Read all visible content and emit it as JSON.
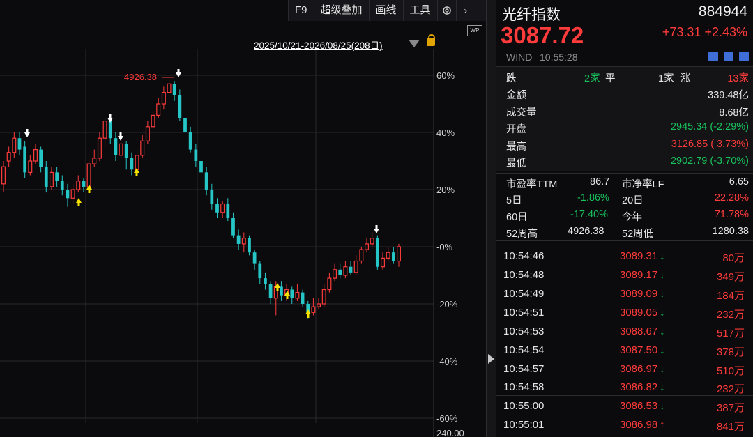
{
  "toolbar": {
    "f9": "F9",
    "overlay": "超级叠加",
    "draw": "画线",
    "tools": "工具",
    "settings_icon": "gear-icon",
    "more_icon": "chevron-right-icon"
  },
  "chart": {
    "wp_badge": "WP",
    "range": "2025/10/21-2026/08/25(208日)",
    "high_marker": "4926.38",
    "y_ticks": [
      "60%",
      "40%",
      "20%",
      "-0%",
      "-20%",
      "-40%",
      "-60%"
    ],
    "bottom_label": "240.00"
  },
  "chart_data": {
    "type": "candlestick",
    "y_axis": "percent change",
    "ylim": [
      -60,
      60
    ],
    "high_value": 4926.38,
    "colors": {
      "up": "#ff3b3b",
      "down": "#26c6c6",
      "grid": "#2a2a2e"
    },
    "candles": [
      [
        22,
        28,
        19,
        30
      ],
      [
        30,
        33,
        28,
        35
      ],
      [
        33,
        38,
        31,
        40
      ],
      [
        38,
        34,
        32,
        40
      ],
      [
        35,
        26,
        24,
        37
      ],
      [
        26,
        30,
        25,
        32
      ],
      [
        30,
        34,
        29,
        36
      ],
      [
        34,
        28,
        26,
        35
      ],
      [
        28,
        21,
        19,
        30
      ],
      [
        21,
        26,
        20,
        28
      ],
      [
        26,
        23,
        21,
        28
      ],
      [
        23,
        20,
        18,
        25
      ],
      [
        20,
        17,
        14,
        22
      ],
      [
        17,
        20,
        15,
        22
      ],
      [
        20,
        23,
        19,
        25
      ],
      [
        23,
        21,
        19,
        24
      ],
      [
        21,
        29,
        20,
        30
      ],
      [
        29,
        31,
        28,
        34
      ],
      [
        31,
        38,
        30,
        40
      ],
      [
        38,
        44,
        35,
        45
      ],
      [
        44,
        38,
        36,
        46
      ],
      [
        38,
        32,
        30,
        40
      ],
      [
        32,
        36,
        31,
        38
      ],
      [
        36,
        31,
        27,
        37
      ],
      [
        31,
        27,
        25,
        33
      ],
      [
        27,
        32,
        26,
        34
      ],
      [
        32,
        37,
        31,
        39
      ],
      [
        37,
        42,
        36,
        44
      ],
      [
        42,
        46,
        41,
        48
      ],
      [
        46,
        50,
        45,
        52
      ],
      [
        50,
        54,
        48,
        56
      ],
      [
        54,
        57,
        52,
        59
      ],
      [
        57,
        53,
        51,
        58
      ],
      [
        53,
        45,
        44,
        55
      ],
      [
        45,
        40,
        37,
        46
      ],
      [
        40,
        34,
        33,
        42
      ],
      [
        34,
        30,
        28,
        36
      ],
      [
        30,
        26,
        24,
        31
      ],
      [
        26,
        20,
        18,
        28
      ],
      [
        20,
        15,
        13,
        22
      ],
      [
        15,
        12,
        10,
        17
      ],
      [
        12,
        15,
        10,
        16
      ],
      [
        15,
        10,
        9,
        17
      ],
      [
        10,
        4,
        3,
        12
      ],
      [
        4,
        1,
        -1,
        6
      ],
      [
        1,
        3,
        -2,
        5
      ],
      [
        3,
        -2,
        -3,
        4
      ],
      [
        -2,
        -6,
        -8,
        -1
      ],
      [
        -6,
        -11,
        -13,
        -5
      ],
      [
        -11,
        -13,
        -15,
        -9
      ],
      [
        -13,
        -18,
        -20,
        -12
      ],
      [
        -18,
        -14,
        -24,
        -12
      ],
      [
        -14,
        -17,
        -19,
        -12
      ],
      [
        -17,
        -15,
        -19,
        -13
      ],
      [
        -15,
        -18,
        -20,
        -14
      ],
      [
        -18,
        -16,
        -19,
        -13
      ],
      [
        -16,
        -20,
        -21,
        -15
      ],
      [
        -20,
        -23,
        -25,
        -19
      ],
      [
        -23,
        -21,
        -24,
        -18
      ],
      [
        -21,
        -20,
        -22,
        -18
      ],
      [
        -20,
        -15,
        -21,
        -13
      ],
      [
        -15,
        -11,
        -16,
        -9
      ],
      [
        -11,
        -8,
        -12,
        -6
      ],
      [
        -8,
        -10,
        -11,
        -6
      ],
      [
        -10,
        -7,
        -11,
        -5
      ],
      [
        -7,
        -9,
        -10,
        -5
      ],
      [
        -9,
        -5,
        -10,
        -3
      ],
      [
        -5,
        -1,
        -6,
        0
      ],
      [
        -1,
        1,
        -2,
        3
      ],
      [
        1,
        3,
        0,
        5
      ],
      [
        3,
        -7,
        -8,
        4
      ],
      [
        -7,
        -4,
        -8,
        -2
      ],
      [
        -4,
        -2,
        -5,
        0
      ],
      [
        -2,
        -5,
        -6,
        0
      ],
      [
        -5,
        0,
        -7,
        1
      ]
    ]
  },
  "quote": {
    "name": "光纤指数",
    "code": "884944",
    "price": "3087.72",
    "change": "+73.31  +2.43%",
    "source": "WIND",
    "time": "10:55:28"
  },
  "breadth": {
    "down_label": "跌",
    "down_val": "2家",
    "flat_label": "平",
    "flat_val": "1家",
    "up_label": "涨",
    "up_val": "13家"
  },
  "stats": [
    {
      "label": "金额",
      "value": "339.48亿",
      "color": "w"
    },
    {
      "label": "成交量",
      "value": "8.68亿",
      "color": "w"
    },
    {
      "label": "开盘",
      "value": "2945.34 (-2.29%)",
      "color": "g"
    },
    {
      "label": "最高",
      "value": "3126.85 ( 3.73%)",
      "color": "r"
    },
    {
      "label": "最低",
      "value": "2902.79 (-3.70%)",
      "color": "g"
    }
  ],
  "metrics": {
    "pe_label": "市盈率TTM",
    "pe_val": "86.7",
    "pb_label": "市净率LF",
    "pb_val": "6.65",
    "d5_label": "5日",
    "d5_val": "-1.86%",
    "d20_label": "20日",
    "d20_val": "22.28%",
    "d60_label": "60日",
    "d60_val": "-17.40%",
    "ytd_label": "今年",
    "ytd_val": "71.78%",
    "wk52h_label": "52周高",
    "wk52h_val": "4926.38",
    "wk52l_label": "52周低",
    "wk52l_val": "1280.38"
  },
  "ticks": [
    {
      "time": "10:54:46",
      "price": "3089.31",
      "dir": "down",
      "vol": "80万"
    },
    {
      "time": "10:54:48",
      "price": "3089.17",
      "dir": "down",
      "vol": "349万"
    },
    {
      "time": "10:54:49",
      "price": "3089.09",
      "dir": "down",
      "vol": "184万"
    },
    {
      "time": "10:54:51",
      "price": "3089.05",
      "dir": "down",
      "vol": "232万"
    },
    {
      "time": "10:54:53",
      "price": "3088.67",
      "dir": "down",
      "vol": "517万"
    },
    {
      "time": "10:54:54",
      "price": "3087.50",
      "dir": "down",
      "vol": "378万"
    },
    {
      "time": "10:54:57",
      "price": "3086.97",
      "dir": "down",
      "vol": "510万"
    },
    {
      "time": "10:54:58",
      "price": "3086.82",
      "dir": "down",
      "vol": "232万"
    },
    {
      "time": "10:55:00",
      "price": "3086.53",
      "dir": "down",
      "vol": "387万"
    },
    {
      "time": "10:55:01",
      "price": "3086.98",
      "dir": "up",
      "vol": "841万"
    }
  ]
}
